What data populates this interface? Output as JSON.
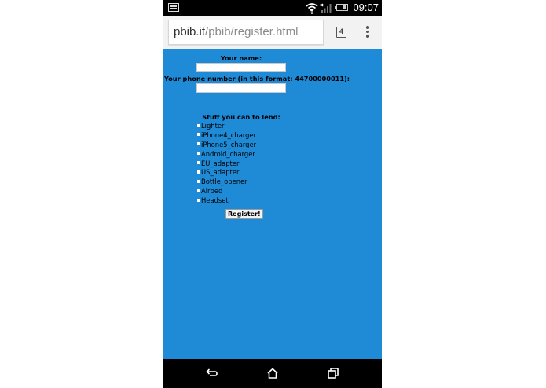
{
  "status_bar": {
    "time": "09:07",
    "icons": [
      "notification-icon",
      "wifi-icon",
      "no-signal-icon",
      "battery-icon"
    ]
  },
  "browser": {
    "url_host": "pbib.it",
    "url_path": "/pbib/register.html",
    "tab_count": "4",
    "menu_icon": "overflow-menu-icon"
  },
  "form": {
    "name_label": "Your name:",
    "name_value": "",
    "phone_label": "Your phone number (in this format: 44700000011):",
    "phone_value": "",
    "stuff_label": "Stuff you can to lend:",
    "items": [
      {
        "label": "Lighter"
      },
      {
        "label": "iPhone4_charger"
      },
      {
        "label": "iPhone5_charger"
      },
      {
        "label": "Android_charger"
      },
      {
        "label": "EU_adapter"
      },
      {
        "label": "US_adapter"
      },
      {
        "label": "Bottle_opener"
      },
      {
        "label": "Airbed"
      },
      {
        "label": "Headset"
      }
    ],
    "register_label": "Register!"
  },
  "colors": {
    "page_background": "#1f8ad6",
    "status_bar": "#000000",
    "toolbar": "#f2f2f2",
    "nav_bar": "#000000"
  },
  "nav_bar": {
    "icons": [
      "back-icon",
      "home-icon",
      "recent-apps-icon"
    ]
  }
}
